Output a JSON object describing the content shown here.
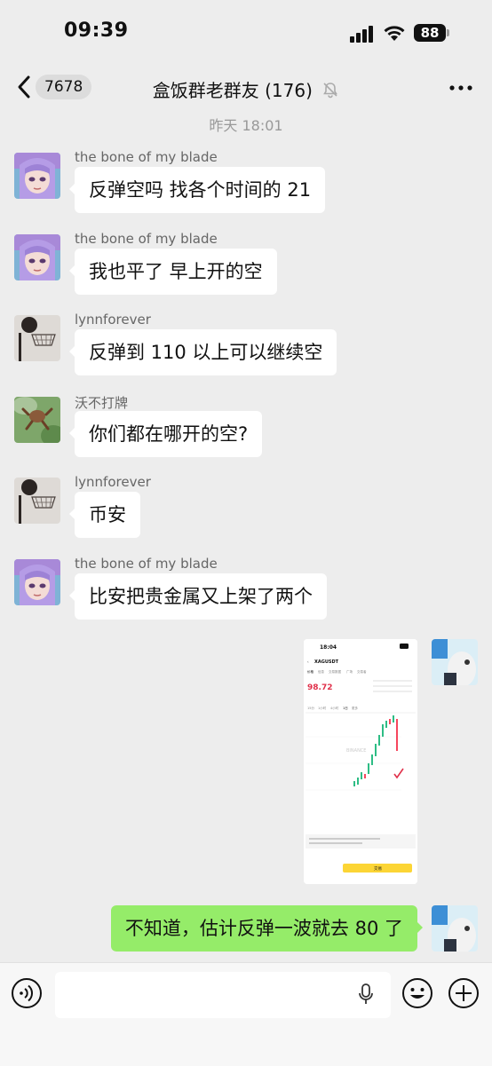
{
  "status_bar": {
    "time": "09:39",
    "battery": "88"
  },
  "header": {
    "unread_count": "7678",
    "title": "盒饭群老群友 (176)"
  },
  "timestamp": "昨天 18:01",
  "messages": [
    {
      "sender": "the bone of my blade",
      "text": "反弹空吗 找各个时间的 21"
    },
    {
      "sender": "the bone of my blade",
      "text": "我也平了 早上开的空"
    },
    {
      "sender": "lynnforever",
      "text": "反弹到 110 以上可以继续空"
    },
    {
      "sender": "沃不打牌",
      "text": "你们都在哪开的空?"
    },
    {
      "sender": "lynnforever",
      "text": "币安"
    },
    {
      "sender": "the bone of my blade",
      "text": "比安把贵金属又上架了两个"
    }
  ],
  "shared_screenshot": {
    "time": "18:04",
    "symbol": "XAGUSDT",
    "price": "98.72",
    "tabs": [
      "价格",
      "信息",
      "交易数据",
      "广场",
      "交易者"
    ],
    "intervals": [
      "15分",
      "1小时",
      "4小时",
      "1日",
      "更多"
    ],
    "watermark": "BINANCE",
    "trade_button": "交易"
  },
  "outgoing": {
    "text": "不知道，估计反弹一波就去 80 了"
  },
  "colors": {
    "outgoing_bubble": "#95ec69",
    "incoming_bubble": "#ffffff",
    "background": "#ededed"
  }
}
